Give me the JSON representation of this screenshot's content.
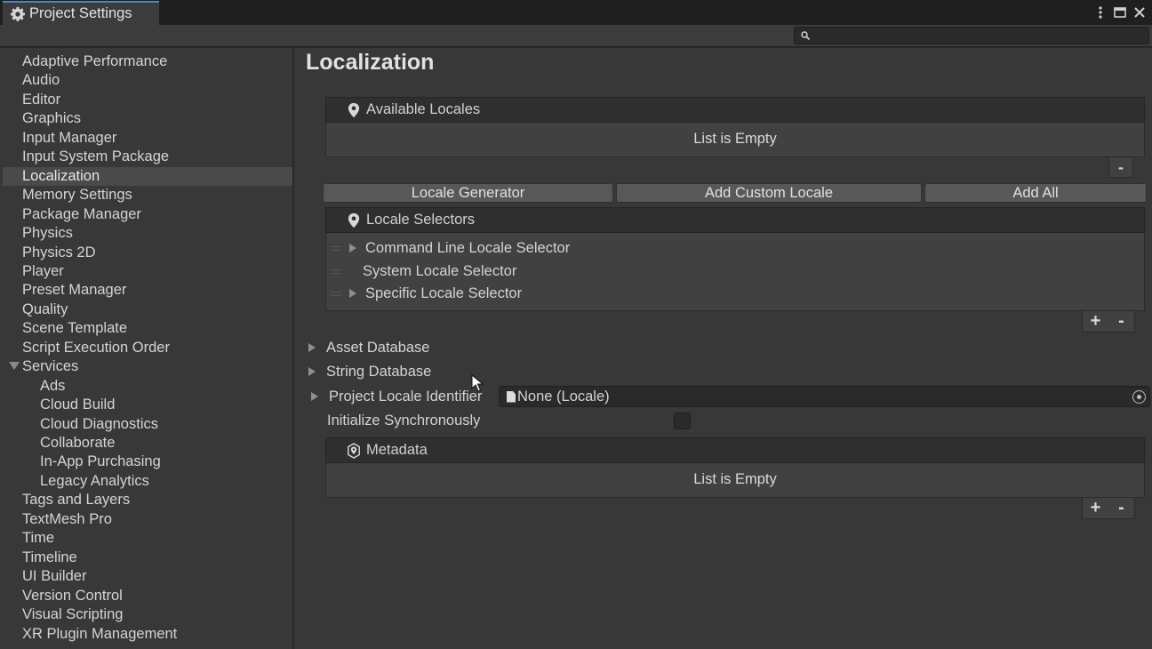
{
  "window": {
    "tab_title": "Project Settings",
    "search_placeholder": "",
    "controls": [
      "more-icon",
      "maximize-icon",
      "close-icon"
    ]
  },
  "sidebar": {
    "items": [
      {
        "label": "Adaptive Performance"
      },
      {
        "label": "Audio"
      },
      {
        "label": "Editor"
      },
      {
        "label": "Graphics"
      },
      {
        "label": "Input Manager"
      },
      {
        "label": "Input System Package"
      },
      {
        "label": "Localization",
        "selected": true
      },
      {
        "label": "Memory Settings"
      },
      {
        "label": "Package Manager"
      },
      {
        "label": "Physics"
      },
      {
        "label": "Physics 2D"
      },
      {
        "label": "Player"
      },
      {
        "label": "Preset Manager"
      },
      {
        "label": "Quality"
      },
      {
        "label": "Scene Template"
      },
      {
        "label": "Script Execution Order"
      },
      {
        "label": "Services",
        "expanded": true
      },
      {
        "label": "Ads",
        "child": true
      },
      {
        "label": "Cloud Build",
        "child": true
      },
      {
        "label": "Cloud Diagnostics",
        "child": true
      },
      {
        "label": "Collaborate",
        "child": true
      },
      {
        "label": "In-App Purchasing",
        "child": true
      },
      {
        "label": "Legacy Analytics",
        "child": true
      },
      {
        "label": "Tags and Layers"
      },
      {
        "label": "TextMesh Pro"
      },
      {
        "label": "Time"
      },
      {
        "label": "Timeline"
      },
      {
        "label": "UI Builder"
      },
      {
        "label": "Version Control"
      },
      {
        "label": "Visual Scripting"
      },
      {
        "label": "XR Plugin Management"
      }
    ]
  },
  "main": {
    "title": "Localization",
    "available_locales": {
      "header": "Available Locales",
      "empty_text": "List is Empty",
      "remove": "-"
    },
    "locale_buttons": {
      "generator": "Locale Generator",
      "add_custom": "Add Custom Locale",
      "add_all": "Add All"
    },
    "locale_selectors": {
      "header": "Locale Selectors",
      "items": [
        "Command Line Locale Selector",
        "System Locale Selector",
        "Specific Locale Selector"
      ],
      "add": "+",
      "remove": "-"
    },
    "asset_database": "Asset Database",
    "string_database": "String Database",
    "project_locale_identifier": {
      "label": "Project Locale Identifier",
      "value": "None (Locale)"
    },
    "initialize_synchronously": {
      "label": "Initialize Synchronously",
      "checked": false
    },
    "metadata": {
      "header": "Metadata",
      "empty_text": "List is Empty",
      "add": "+",
      "remove": "-"
    }
  },
  "colors": {
    "background": "#383838",
    "header_bar": "#1f1f1f",
    "selected_item": "#4a4a4a",
    "tab_accent": "#4a87c8"
  }
}
